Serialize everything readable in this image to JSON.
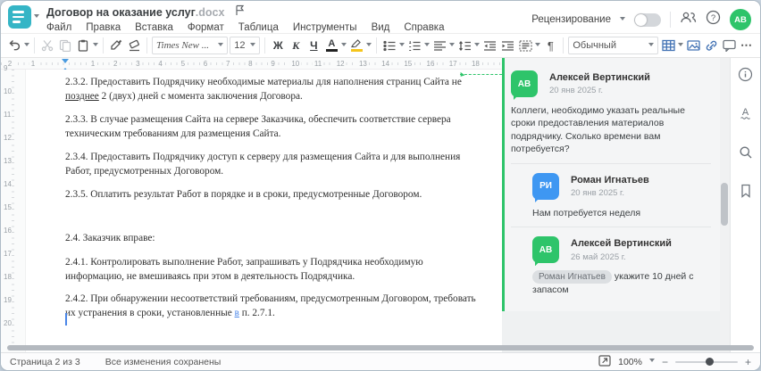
{
  "header": {
    "title": "Договор на оказание услуг",
    "title_ext": ".docx",
    "menu": [
      "Файл",
      "Правка",
      "Вставка",
      "Формат",
      "Таблица",
      "Инструменты",
      "Вид",
      "Справка"
    ],
    "review_label": "Рецензирование",
    "avatar_initials": "АВ"
  },
  "toolbar": {
    "font_name": "Times New ...",
    "font_size": "12",
    "bold": "Ж",
    "italic": "К",
    "underline": "Ч",
    "font_color_letter": "А",
    "pilcrow": "¶",
    "style_name": "Обычный",
    "more": "⋯"
  },
  "ruler": {
    "h_margin_numbers": [
      "2",
      "1"
    ],
    "h_numbers": [
      "1",
      "2",
      "3",
      "4",
      "5",
      "6",
      "7",
      "8",
      "9",
      "10",
      "11",
      "12",
      "13",
      "14",
      "15",
      "16",
      "17",
      "18"
    ],
    "v_numbers": [
      "9",
      "10",
      "11",
      "12",
      "13",
      "14",
      "15",
      "16",
      "17",
      "18",
      "19",
      "20"
    ]
  },
  "document": {
    "paragraphs": [
      {
        "gap": 10,
        "lines": [
          [
            {
              "t": "2.3.2. Предоставить Подрядчику необходимые материалы для наполнения страниц Сайта не"
            }
          ],
          [
            {
              "t": "позднее",
              "s": "anchor"
            },
            {
              "t": " 2 (двух) дней с момента заключения Договора."
            }
          ]
        ]
      },
      {
        "gap": 10,
        "lines": [
          [
            {
              "t": "2.3.3. В случае размещения Сайта на сервере Заказчика, обеспечить соответствие сервера"
            }
          ],
          [
            {
              "t": "техническим требованиям для размещения Сайта."
            }
          ]
        ]
      },
      {
        "gap": 10,
        "lines": [
          [
            {
              "t": "2.3.4. Предоставить Подрядчику доступ к серверу для размещения Сайта и для выполнения"
            }
          ],
          [
            {
              "t": "Работ, предусмотренных Договором."
            }
          ]
        ]
      },
      {
        "gap": 33,
        "lines": [
          [
            {
              "t": "2.3.5. Оплатить результат Работ в порядке и в сроки, предусмотренные Договором."
            }
          ]
        ]
      },
      {
        "gap": 11,
        "lines": [
          [
            {
              "t": "2.4. Заказчик вправе:"
            }
          ]
        ]
      },
      {
        "gap": 9,
        "lines": [
          [
            {
              "t": "2.4.1. Контролировать выполнение Работ, запрашивать у Подрядчика необходимую"
            }
          ],
          [
            {
              "t": "информацию, не вмешиваясь при этом в деятельность Подрядчика."
            }
          ]
        ]
      },
      {
        "gap": 0,
        "lines": [
          [
            {
              "t": "2.4.2. При обнаружении несоответствий требованиям, предусмотренным Договором, требовать"
            }
          ],
          [
            {
              "t": "их устранения в сроки, установленные "
            },
            {
              "t": "в",
              "s": "collab"
            },
            {
              "t": " п. 2.7.1."
            }
          ]
        ]
      }
    ]
  },
  "comments": {
    "items": [
      {
        "initials": "АВ",
        "avatar_color": "#2ec46a",
        "name": "Алексей Вертинский",
        "date": "20 янв 2025 г.",
        "text": "Коллеги, необходимо указать реальные сроки предоставления материалов подрядчику. Сколько времени вам потребуется?",
        "reply": false
      },
      {
        "initials": "РИ",
        "avatar_color": "#3e97f2",
        "name": "Роман Игнатьев",
        "date": "20 янв 2025 г.",
        "text": "Нам потребуется неделя",
        "reply": true
      },
      {
        "initials": "АВ",
        "avatar_color": "#2ec46a",
        "name": "Алексей Вертинский",
        "date": "26 май 2025 г.",
        "mention": "Роман Игнатьев",
        "text": " укажите 10 дней с запасом",
        "reply": true
      }
    ]
  },
  "statusbar": {
    "page_info": "Страница 2 из 3",
    "saved_info": "Все изменения сохранены",
    "zoom_value": "100%",
    "zoom_out": "−",
    "zoom_in": "+"
  },
  "colors": {
    "brand_teal": "#35b5c6",
    "accent_green": "#2ec46a",
    "avatar_blue": "#3e97f2",
    "icon_blue": "#4272b4",
    "marker_blue": "#4a9be0",
    "cursor_blue": "#4a86e8",
    "highlight_yellow": "#f5c51c"
  }
}
